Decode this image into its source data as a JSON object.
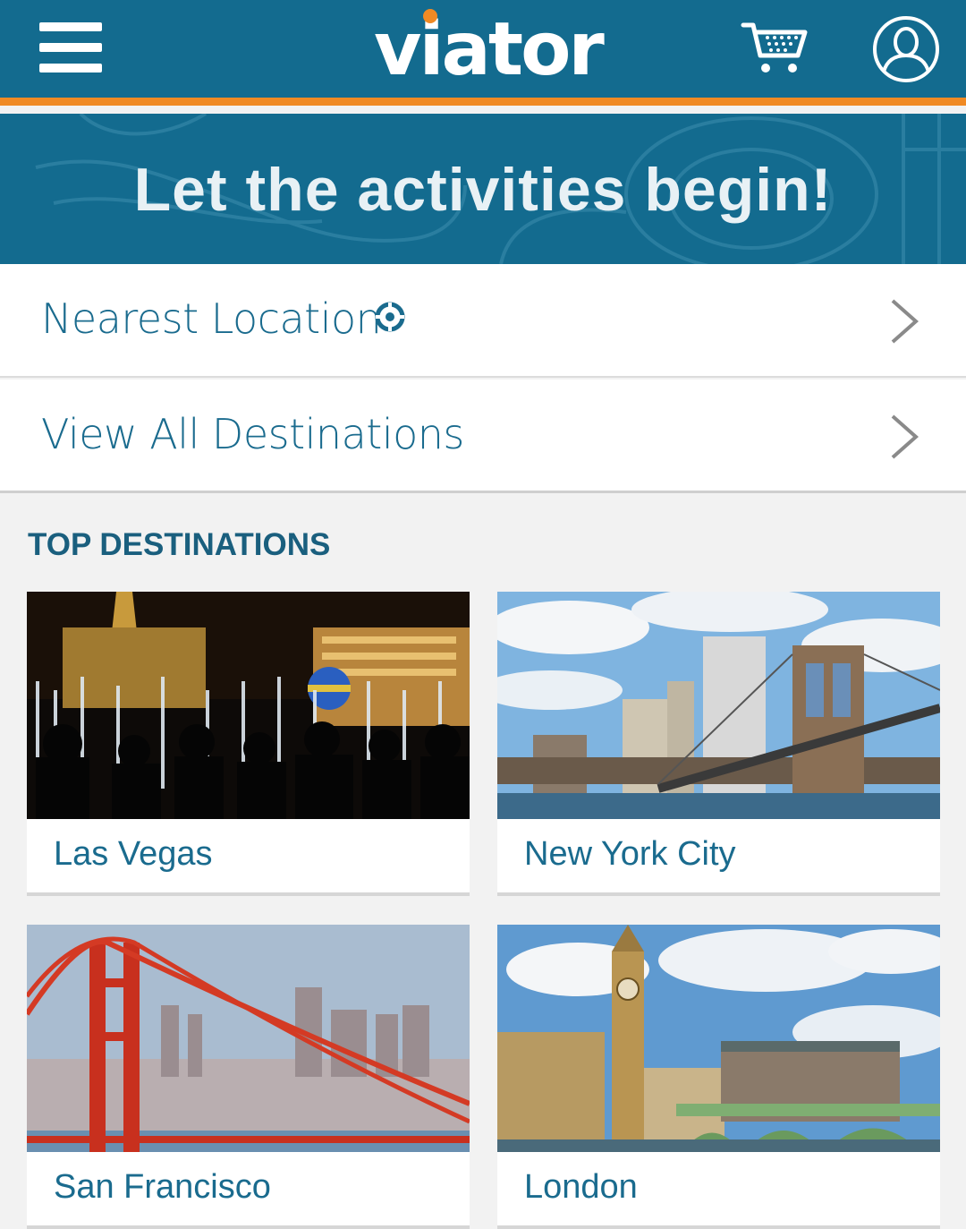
{
  "header": {
    "logo_text": "viator",
    "brand_color": "#136b8f",
    "accent_color": "#f08a24",
    "icons": [
      "menu-icon",
      "cart-icon",
      "account-icon"
    ]
  },
  "hero": {
    "title": "Let the activities begin!"
  },
  "nav": {
    "nearest_location": "Nearest Location",
    "view_all": "View All Destinations"
  },
  "top_destinations": {
    "heading": "TOP DESTINATIONS",
    "items": [
      {
        "name": "Las Vegas"
      },
      {
        "name": "New York City"
      },
      {
        "name": "San Francisco"
      },
      {
        "name": "London"
      }
    ]
  }
}
